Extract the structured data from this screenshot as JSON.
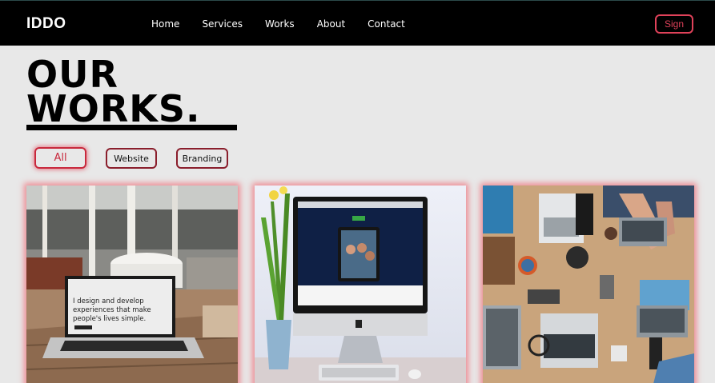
{
  "header": {
    "logo": "IDDO",
    "nav": [
      "Home",
      "Services",
      "Works",
      "About",
      "Contact"
    ],
    "sign_label": "Sign"
  },
  "hero": {
    "title_line1": "OUR",
    "title_line2": "WORKS."
  },
  "filters": {
    "all": "All",
    "website": "Website",
    "branding": "Branding",
    "active": "All"
  },
  "works": {
    "laptop_text_line1": "I design and develop",
    "laptop_text_line2": "experiences that make",
    "laptop_text_line3": "people's lives simple."
  },
  "colors": {
    "accent": "#e0425a",
    "header_bg": "#000000",
    "page_bg": "#e8e8e8"
  }
}
